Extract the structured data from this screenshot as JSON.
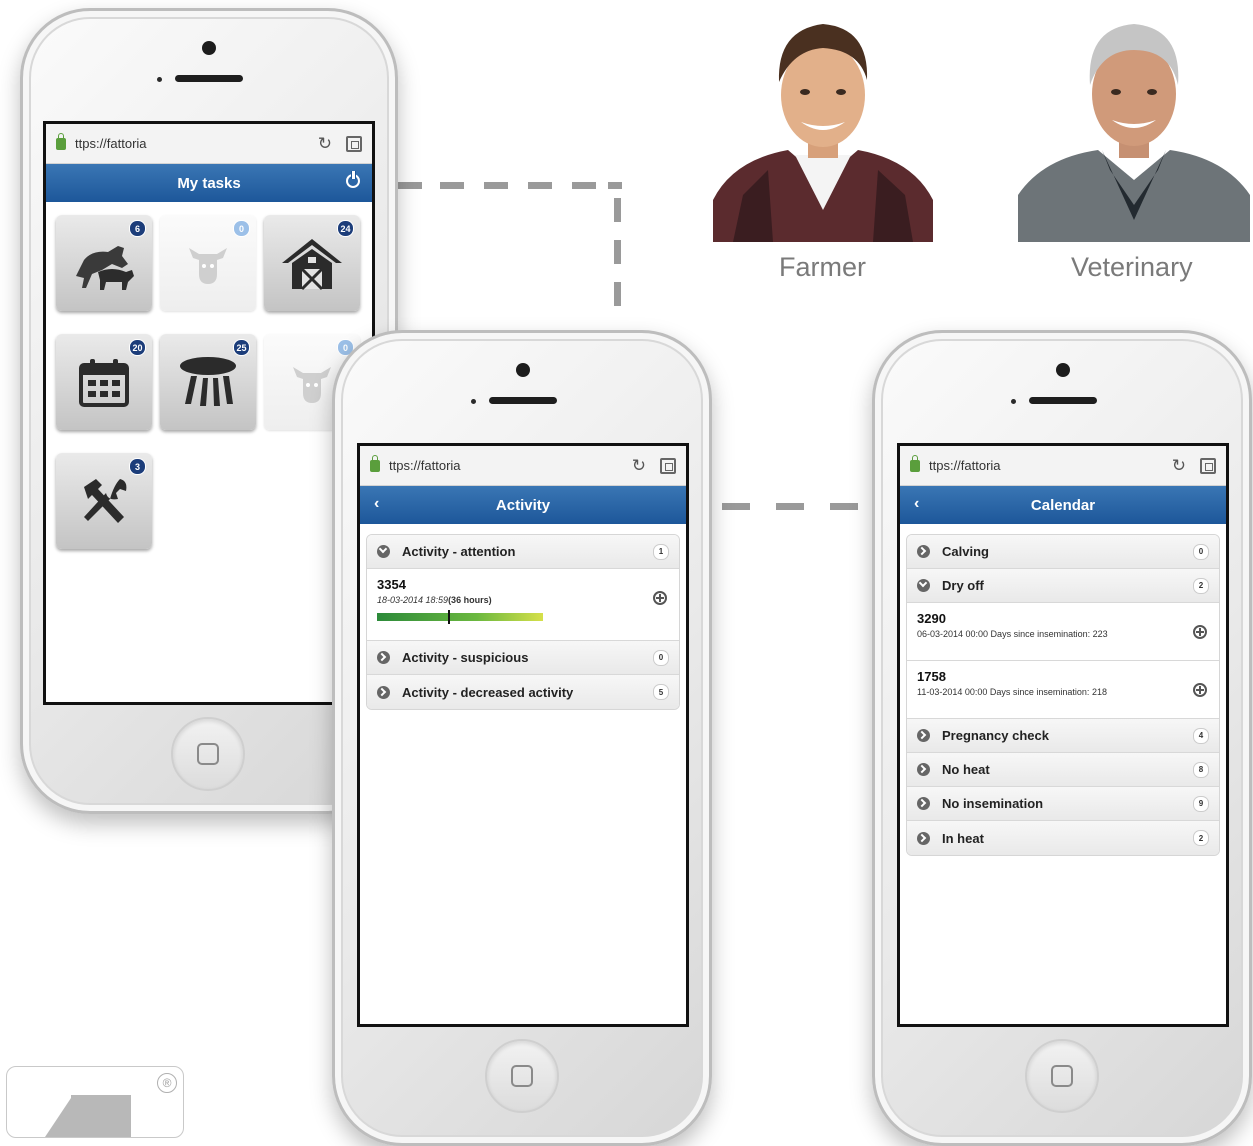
{
  "persons": [
    {
      "label": "Farmer"
    },
    {
      "label": "Veterinary"
    }
  ],
  "url": "ttps://fattoria",
  "tasks_screen": {
    "title": "My tasks",
    "tiles": [
      {
        "icon": "cattle-mounting-icon",
        "badge": "6",
        "dim": false
      },
      {
        "icon": "cow-head-icon",
        "badge": "0",
        "dim": true
      },
      {
        "icon": "barn-icon",
        "badge": "24",
        "dim": false
      },
      {
        "icon": "calendar-icon",
        "badge": "20",
        "dim": false
      },
      {
        "icon": "milking-cluster-icon",
        "badge": "25",
        "dim": false
      },
      {
        "icon": "cow-head-icon",
        "badge": "0",
        "dim": true
      },
      {
        "icon": "tools-icon",
        "badge": "3",
        "dim": false
      }
    ]
  },
  "activity_screen": {
    "title": "Activity",
    "groups": [
      {
        "label": "Activity - attention",
        "count": "1",
        "expanded": true,
        "items": [
          {
            "id": "3354",
            "date": "18-03-2014 18:59",
            "hours": "(36 hours)",
            "level": 0.43
          }
        ]
      },
      {
        "label": "Activity - suspicious",
        "count": "0",
        "expanded": false
      },
      {
        "label": "Activity - decreased activity",
        "count": "5",
        "expanded": false
      }
    ]
  },
  "calendar_screen": {
    "title": "Calendar",
    "groups": [
      {
        "label": "Calving",
        "count": "0",
        "expanded": false
      },
      {
        "label": "Dry off",
        "count": "2",
        "expanded": true,
        "items": [
          {
            "id": "3290",
            "detail": "06-03-2014 00:00 Days since insemination: 223"
          },
          {
            "id": "1758",
            "detail": "11-03-2014 00:00 Days since insemination: 218"
          }
        ]
      },
      {
        "label": "Pregnancy check",
        "count": "4",
        "expanded": false
      },
      {
        "label": "No heat",
        "count": "8",
        "expanded": false
      },
      {
        "label": "No insemination",
        "count": "9",
        "expanded": false
      },
      {
        "label": "In heat",
        "count": "2",
        "expanded": false
      }
    ]
  },
  "logo": {
    "registered_mark": "®"
  }
}
